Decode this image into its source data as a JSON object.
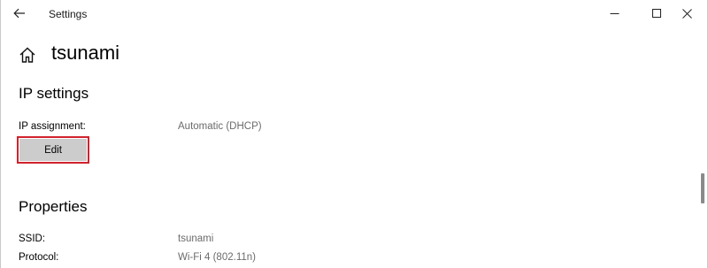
{
  "window": {
    "app_title": "Settings"
  },
  "header": {
    "page_title": "tsunami"
  },
  "ip_settings": {
    "section_title": "IP settings",
    "assignment_label": "IP assignment:",
    "assignment_value": "Automatic (DHCP)",
    "edit_label": "Edit"
  },
  "properties": {
    "section_title": "Properties",
    "rows": [
      {
        "label": "SSID:",
        "value": "tsunami"
      },
      {
        "label": "Protocol:",
        "value": "Wi-Fi 4 (802.11n)"
      }
    ]
  },
  "icons": {
    "back": "back-arrow-icon",
    "minimize": "minimize-icon",
    "maximize": "maximize-icon",
    "close": "close-icon",
    "home": "home-icon"
  },
  "colors": {
    "highlight_border": "#d1232d",
    "button_fill": "#cccccc",
    "value_text": "#6b6b6b"
  }
}
